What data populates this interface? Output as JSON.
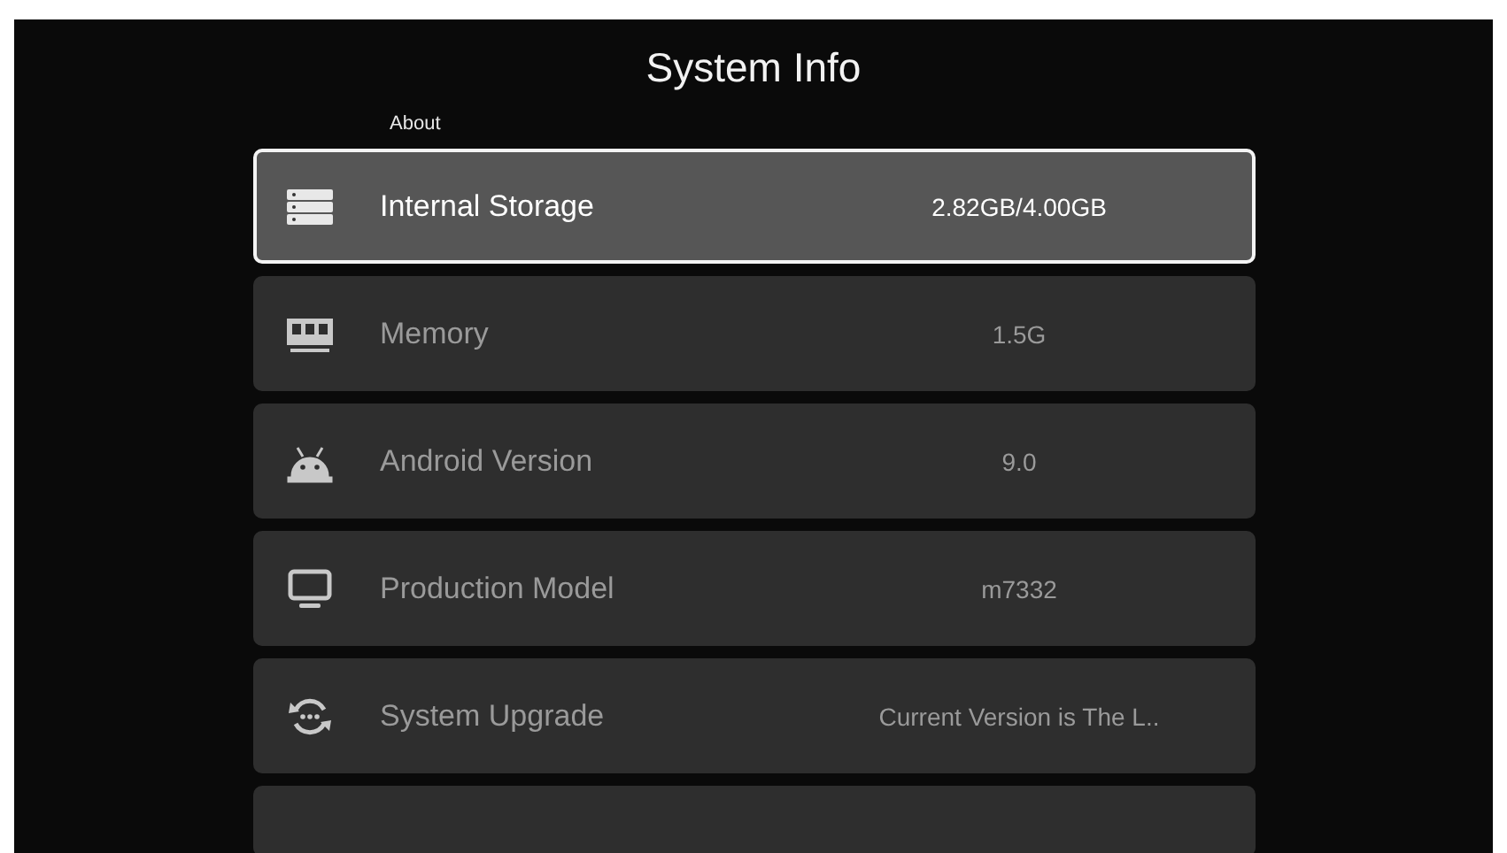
{
  "title": "System Info",
  "section": "About",
  "items": [
    {
      "label": "Internal Storage",
      "value": "2.82GB/4.00GB",
      "selected": true
    },
    {
      "label": "Memory",
      "value": "1.5G",
      "selected": false
    },
    {
      "label": "Android Version",
      "value": "9.0",
      "selected": false
    },
    {
      "label": "Production Model",
      "value": "m7332",
      "selected": false
    },
    {
      "label": "System Upgrade",
      "value": "Current Version is The L..",
      "selected": false
    }
  ]
}
